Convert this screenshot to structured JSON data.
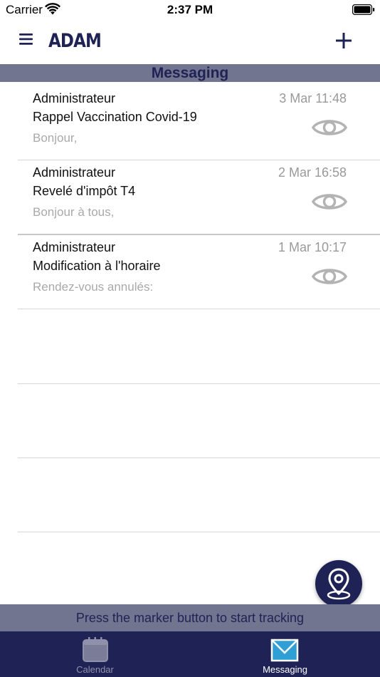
{
  "status_bar": {
    "carrier": "Carrier",
    "time": "2:37 PM"
  },
  "nav": {
    "logo": "ADAM",
    "menu_icon": "hamburger-menu-icon",
    "add_icon": "plus-icon"
  },
  "section": {
    "title": "Messaging"
  },
  "messages": [
    {
      "sender": "Administrateur",
      "date": "3 Mar 11:48",
      "subject": "Rappel Vaccination Covid-19",
      "preview": "Bonjour,"
    },
    {
      "sender": "Administrateur",
      "date": "2 Mar 16:58",
      "subject": "Revelé d'impôt T4",
      "preview": "Bonjour à tous,"
    },
    {
      "sender": "Administrateur",
      "date": "1 Mar 10:17",
      "subject": "Modification à l'horaire",
      "preview": "Rendez-vous annulés:"
    }
  ],
  "tracking": {
    "text": "Press the marker button to start tracking"
  },
  "tabs": [
    {
      "label": "Calendar",
      "icon": "calendar-icon",
      "active": false
    },
    {
      "label": "Messaging",
      "icon": "mail-icon",
      "active": true
    }
  ],
  "colors": {
    "brand": "#1f2255",
    "header_bg": "#72758f",
    "muted_text": "#a9a9a9",
    "eye_icon": "#b3b3b3"
  }
}
